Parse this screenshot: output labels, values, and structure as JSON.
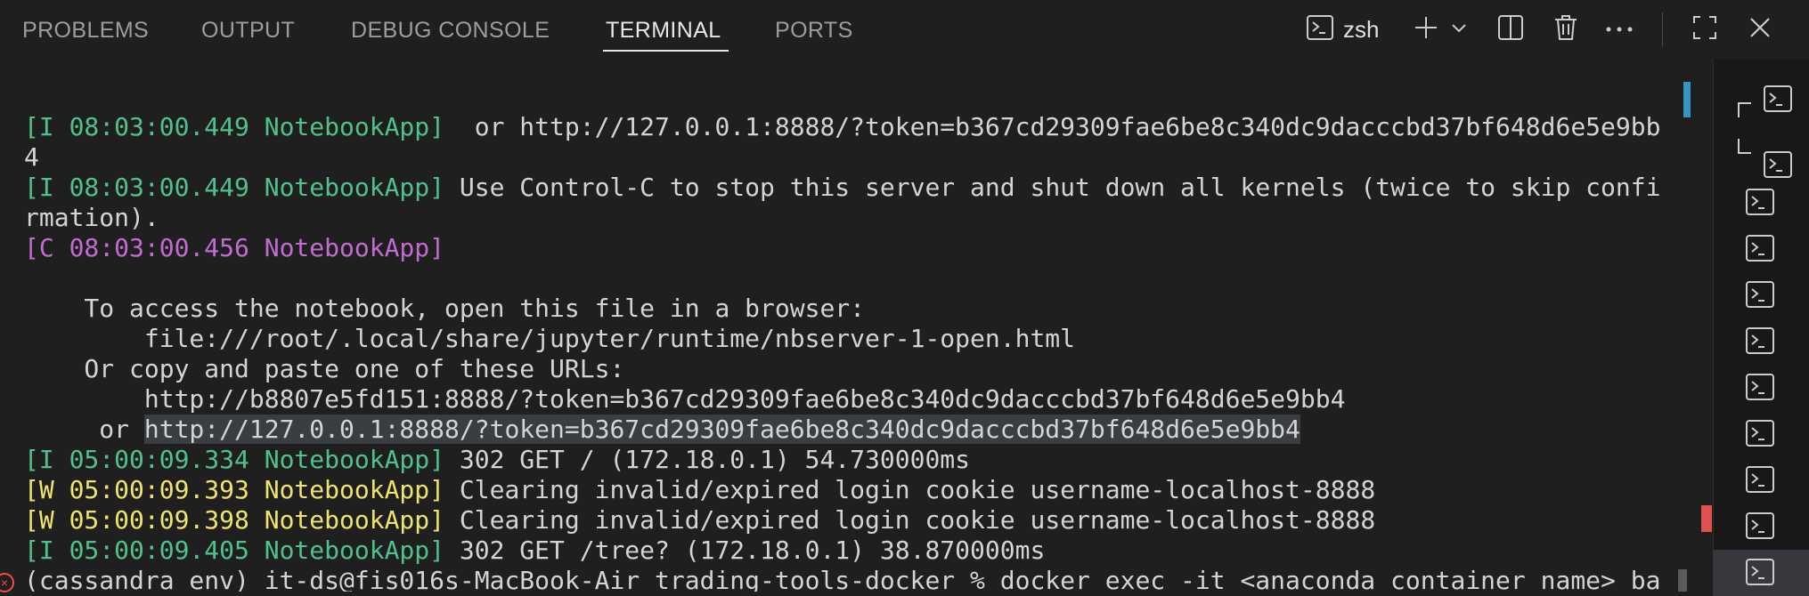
{
  "tabs": [
    {
      "label": "PROBLEMS",
      "active": false
    },
    {
      "label": "OUTPUT",
      "active": false
    },
    {
      "label": "DEBUG CONSOLE",
      "active": false
    },
    {
      "label": "TERMINAL",
      "active": true
    },
    {
      "label": "PORTS",
      "active": false
    }
  ],
  "toolbar": {
    "shell": "zsh",
    "icons": [
      "terminal-icon",
      "plus-icon",
      "chevron-down-icon",
      "split-icon",
      "trash-icon",
      "ellipsis-icon",
      "maximize-icon",
      "close-icon"
    ]
  },
  "terminal": {
    "lines": [
      {
        "prefix": "[I 08:03:00.449 NotebookApp]",
        "prefix_color": "#4fc28b",
        "text": "  or http://127.0.0.1:8888/?token=b367cd29309fae6be8c340dc9dacccbd37bf648d6e5e9bb"
      },
      {
        "prefix": "",
        "text": "4"
      },
      {
        "prefix": "[I 08:03:00.449 NotebookApp]",
        "prefix_color": "#4fc28b",
        "text": " Use Control-C to stop this server and shut down all kernels (twice to skip confi"
      },
      {
        "prefix": "",
        "text": "rmation)."
      },
      {
        "prefix": "[C 08:03:00.456 NotebookApp]",
        "prefix_color": "#c36ad3",
        "text": ""
      },
      {
        "prefix": "",
        "text": ""
      },
      {
        "prefix": "",
        "text": "    To access the notebook, open this file in a browser:"
      },
      {
        "prefix": "",
        "text": "        file:///root/.local/share/jupyter/runtime/nbserver-1-open.html"
      },
      {
        "prefix": "",
        "text": "    Or copy and paste one of these URLs:"
      },
      {
        "prefix": "",
        "text": "        http://b8807e5fd151:8888/?token=b367cd29309fae6be8c340dc9dacccbd37bf648d6e5e9bb4"
      },
      {
        "prefix": "",
        "text": "     or ",
        "selected": "http://127.0.0.1:8888/?token=b367cd29309fae6be8c340dc9dacccbd37bf648d6e5e9bb4"
      },
      {
        "prefix": "[I 05:00:09.334 NotebookApp]",
        "prefix_color": "#4fc28b",
        "text": " 302 GET / (172.18.0.1) 54.730000ms"
      },
      {
        "prefix": "[W 05:00:09.393 NotebookApp]",
        "prefix_color": "#f0e36c",
        "text": " Clearing invalid/expired login cookie username-localhost-8888"
      },
      {
        "prefix": "[W 05:00:09.398 NotebookApp]",
        "prefix_color": "#f0e36c",
        "text": " Clearing invalid/expired login cookie username-localhost-8888"
      },
      {
        "prefix": "[I 05:00:09.405 NotebookApp]",
        "prefix_color": "#4fc28b",
        "text": " 302 GET /tree? (172.18.0.1) 38.870000ms"
      },
      {
        "prefix": "",
        "text": "(cassandra_env) it-ds@fis016s-MacBook-Air trading-tools-docker % docker exec -it <anaconda_container_name> ba"
      }
    ]
  },
  "side_panel": {
    "items": [
      "terminal-tree-top",
      "terminal-tree-child",
      "terminal-3",
      "terminal-4",
      "terminal-5",
      "terminal-6",
      "terminal-7",
      "terminal-8",
      "terminal-9",
      "terminal-10",
      "terminal-11"
    ]
  }
}
